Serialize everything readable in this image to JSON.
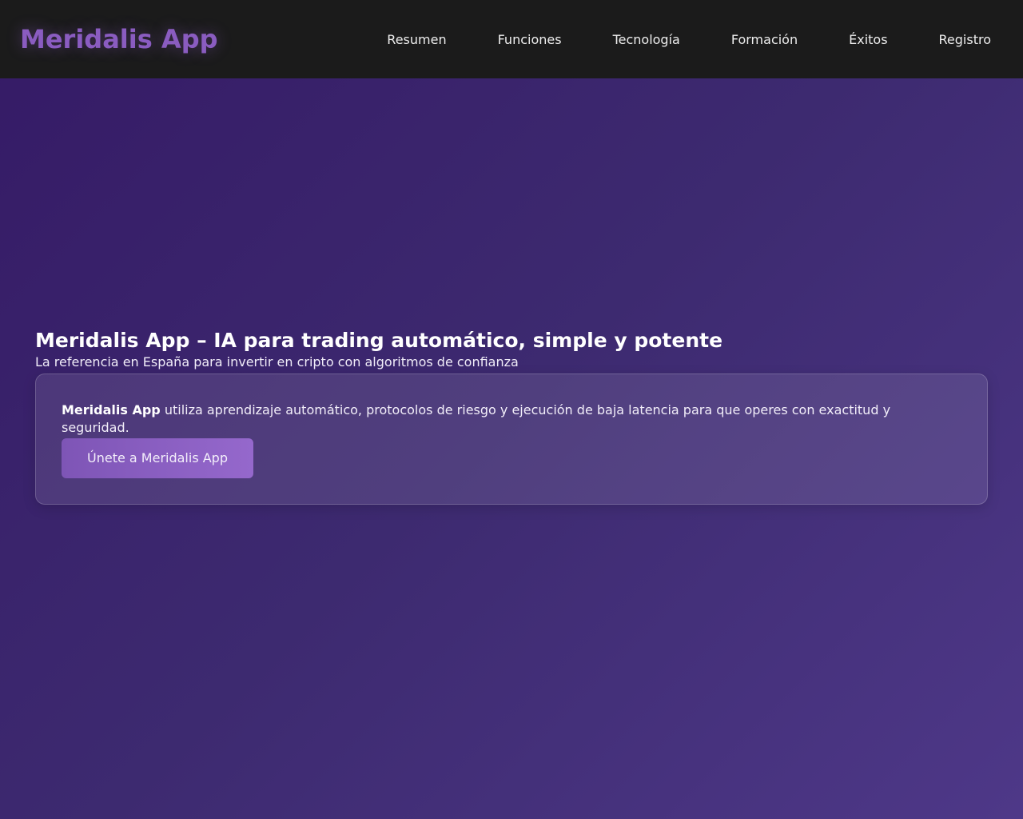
{
  "header": {
    "logo": "Meridalis App",
    "nav": [
      "Resumen",
      "Funciones",
      "Tecnología",
      "Formación",
      "Éxitos",
      "Registro"
    ]
  },
  "hero": {
    "title": "Meridalis App – IA para trading automático, simple y potente",
    "subtitle": "La referencia en España para invertir en cripto con algoritmos de confianza",
    "card": {
      "brand": "Meridalis App",
      "text": " utiliza aprendizaje automático, protocolos de riesgo y ejecución de baja latencia para que operes con exactitud y seguridad.",
      "cta": "Únete a Meridalis App"
    }
  },
  "colors": {
    "accent": "#8a5cc0",
    "header_bg": "#1b1b1b"
  }
}
